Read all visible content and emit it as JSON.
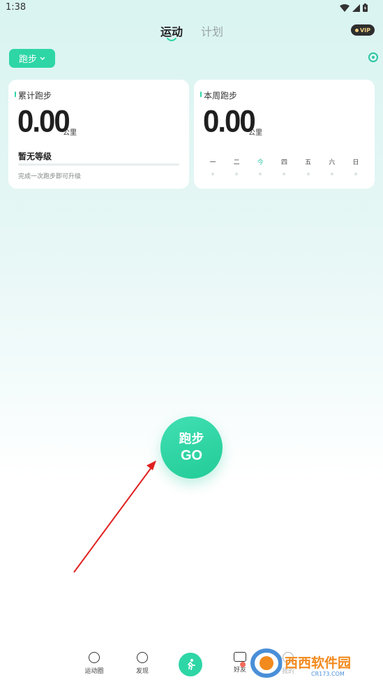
{
  "status_bar": {
    "time": "1:38"
  },
  "tabs": {
    "active": "运动",
    "inactive": "计划"
  },
  "vip": {
    "label": "VIP"
  },
  "activity_select": {
    "label": "跑步"
  },
  "total_card": {
    "title": "累计跑步",
    "distance": "0.00",
    "unit": "公里",
    "level": "暂无等级",
    "level_progress": 0,
    "hint": "完成一次跑步即可升级"
  },
  "week_card": {
    "title": "本周跑步",
    "distance": "0.00",
    "unit": "公里",
    "days": [
      "一",
      "二",
      "今",
      "四",
      "五",
      "六",
      "日"
    ]
  },
  "go_button": {
    "line1": "跑步",
    "line2": "GO"
  },
  "bottom_nav": {
    "items": [
      {
        "label": "运动圈",
        "icon": "chat-bubble-icon"
      },
      {
        "label": "发现",
        "icon": "compass-icon"
      },
      {
        "label": "",
        "icon": "runner-icon"
      },
      {
        "label": "好友",
        "icon": "message-icon"
      },
      {
        "label": "我的",
        "icon": "profile-icon"
      }
    ]
  },
  "watermark": {
    "text": "西西软件园",
    "url_text": "CR173.COM"
  },
  "colors": {
    "accent": "#2ed6a6",
    "arrow": "#e02020",
    "vip_bg": "#2e2e2e",
    "vip_text": "#f0cf82"
  }
}
